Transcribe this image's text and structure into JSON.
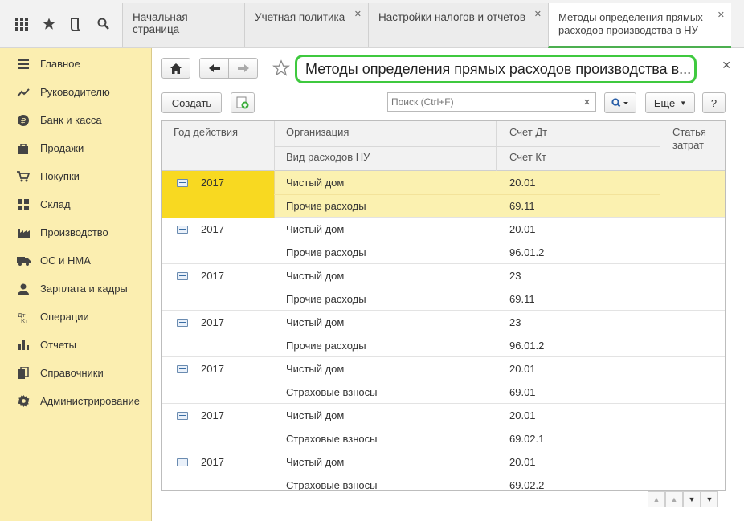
{
  "tabs": [
    {
      "label": "Начальная страница"
    },
    {
      "label": "Учетная политика"
    },
    {
      "label": "Настройки налогов и отчетов"
    },
    {
      "label": "Методы определения прямых расходов производства в НУ"
    }
  ],
  "sidebar": {
    "items": [
      {
        "label": "Главное",
        "icon": "menu-icon"
      },
      {
        "label": "Руководителю",
        "icon": "trend-icon"
      },
      {
        "label": "Банк и касса",
        "icon": "ruble-icon"
      },
      {
        "label": "Продажи",
        "icon": "bag-icon"
      },
      {
        "label": "Покупки",
        "icon": "cart-icon"
      },
      {
        "label": "Склад",
        "icon": "warehouse-icon"
      },
      {
        "label": "Производство",
        "icon": "factory-icon"
      },
      {
        "label": "ОС и НМА",
        "icon": "truck-icon"
      },
      {
        "label": "Зарплата и кадры",
        "icon": "people-icon"
      },
      {
        "label": "Операции",
        "icon": "dt-kt-icon"
      },
      {
        "label": "Отчеты",
        "icon": "bar-chart-icon"
      },
      {
        "label": "Справочники",
        "icon": "books-icon"
      },
      {
        "label": "Администрирование",
        "icon": "gear-icon"
      }
    ]
  },
  "form": {
    "title": "Методы определения прямых расходов производства в...",
    "create_label": "Создать",
    "search_placeholder": "Поиск (Ctrl+F)",
    "more_label": "Еще",
    "help_label": "?"
  },
  "table": {
    "headers": {
      "year": "Год действия",
      "org": "Организация",
      "expense_type": "Вид расходов НУ",
      "debit": "Счет Дт",
      "credit": "Счет Кт",
      "cost_item": "Статья затрат"
    },
    "rows": [
      {
        "year": "2017",
        "org": "Чистый дом",
        "expense_type": "Прочие расходы",
        "debit": "20.01",
        "credit": "69.11",
        "selected": true
      },
      {
        "year": "2017",
        "org": "Чистый дом",
        "expense_type": "Прочие расходы",
        "debit": "20.01",
        "credit": "96.01.2"
      },
      {
        "year": "2017",
        "org": "Чистый дом",
        "expense_type": "Прочие расходы",
        "debit": "23",
        "credit": "69.11"
      },
      {
        "year": "2017",
        "org": "Чистый дом",
        "expense_type": "Прочие расходы",
        "debit": "23",
        "credit": "96.01.2"
      },
      {
        "year": "2017",
        "org": "Чистый дом",
        "expense_type": "Страховые взносы",
        "debit": "20.01",
        "credit": "69.01"
      },
      {
        "year": "2017",
        "org": "Чистый дом",
        "expense_type": "Страховые взносы",
        "debit": "20.01",
        "credit": "69.02.1"
      },
      {
        "year": "2017",
        "org": "Чистый дом",
        "expense_type": "Страховые взносы",
        "debit": "20.01",
        "credit": "69.02.2"
      }
    ]
  },
  "colors": {
    "sidebar_bg": "#fbeeb0",
    "selected_row": "#fbf1b0",
    "selected_cell": "#f8d921",
    "title_highlight": "#3fc93f"
  }
}
